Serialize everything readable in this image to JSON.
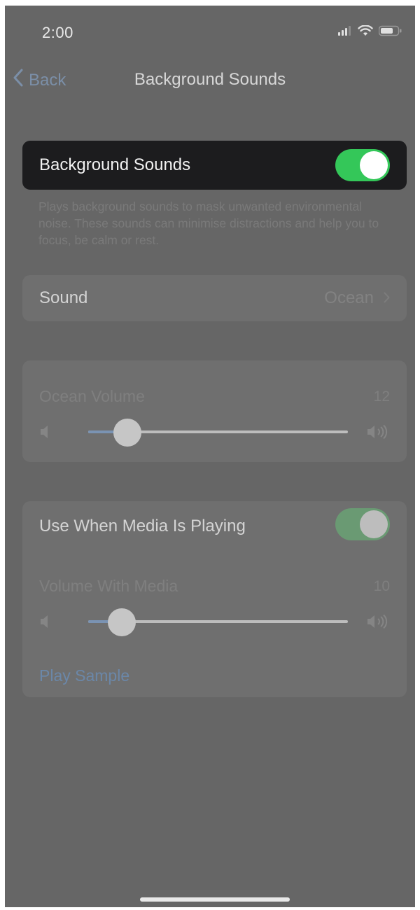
{
  "status_bar": {
    "time": "2:00",
    "icons": [
      "cellular-signal-icon",
      "wifi-icon",
      "battery-icon"
    ]
  },
  "nav": {
    "back_label": "Back",
    "title": "Background Sounds"
  },
  "main_toggle": {
    "label": "Background Sounds",
    "on": true
  },
  "description": "Plays background sounds to mask unwanted environmental noise. These sounds can minimise distractions and help you to focus, be calm or rest.",
  "sound": {
    "label": "Sound",
    "value": "Ocean"
  },
  "volume": {
    "label": "Ocean Volume",
    "value": "12",
    "level": 0.15
  },
  "media": {
    "label": "Use When Media Is Playing",
    "on": true,
    "volume_label": "Volume With Media",
    "volume_value": "10",
    "level": 0.13,
    "play_sample": "Play Sample"
  },
  "colors": {
    "background": "#666666",
    "toggle_on": "#34c759",
    "accent_link": "#6b87a8"
  }
}
